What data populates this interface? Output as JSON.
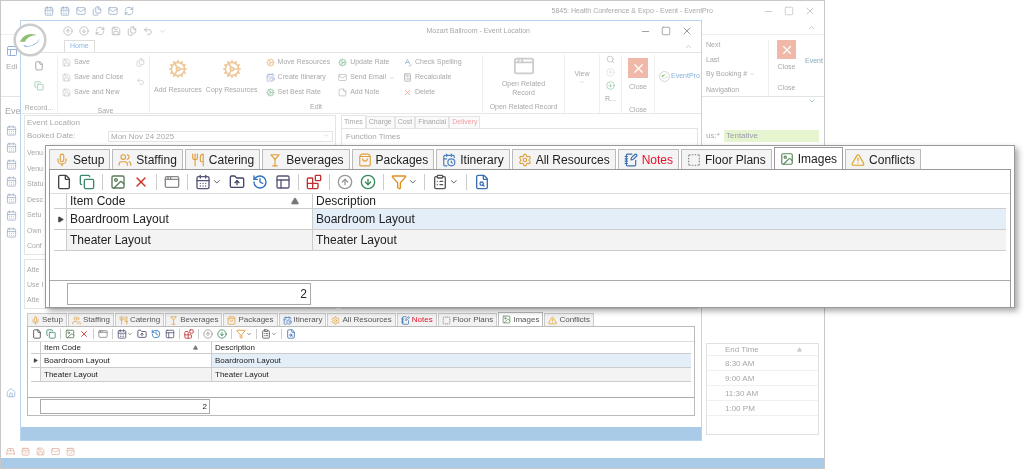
{
  "outer_window": {
    "title": "5845: Health Conference & Expo - Event - EventPro",
    "ribbon_label": "Edi",
    "section_label": "Eve",
    "navigation": {
      "items": [
        {
          "label": "Next",
          "dropdown": false
        },
        {
          "label": "Last",
          "dropdown": false
        },
        {
          "label": "By Booking #",
          "dropdown": true
        }
      ],
      "group": "Navigation"
    },
    "close": {
      "button": "Close",
      "group": "Close"
    },
    "logo_text": "Event",
    "status": {
      "label": "us:*",
      "value": "Tentative"
    },
    "times_grid": {
      "column": {
        "label": "End Time",
        "sorted": true
      },
      "rows": [
        "8:30 AM",
        "9:00 AM",
        "11:30 AM",
        "1:00 PM"
      ]
    }
  },
  "inner_window": {
    "title": "Mozart Ballroom - Event Location",
    "ribbon_tabs": [
      {
        "label": "Home",
        "selected": true
      }
    ],
    "ribbon": {
      "record": {
        "label": "Record..."
      },
      "save": {
        "items": [
          "Save",
          "Save and Close",
          "Save and New"
        ],
        "label": "Save"
      },
      "edit": {
        "large": [
          "Add Resources",
          "Copy Resources"
        ],
        "small": [
          {
            "label": "Move Resources",
            "dropdown": false
          },
          {
            "label": "Create Itinerary",
            "dropdown": false
          },
          {
            "label": "Set Best Rate",
            "dropdown": false
          },
          {
            "label": "Update Rate",
            "dropdown": false
          },
          {
            "label": "Send Email",
            "dropdown": true
          },
          {
            "label": "Add Note",
            "dropdown": false
          },
          {
            "label": "Check Spelling",
            "dropdown": false
          },
          {
            "label": "Recalculate",
            "dropdown": false
          },
          {
            "label": "Delete",
            "dropdown": false
          }
        ],
        "label": "Edit"
      },
      "related": {
        "button": "Open Related Record",
        "label": "Open Related Record"
      },
      "view": {
        "button": "View"
      },
      "reorder": {
        "label": "R..."
      },
      "close": {
        "button": "Close",
        "label": "Close"
      },
      "logo_text": "EventPro"
    },
    "form": {
      "group": "Event Location",
      "booked": {
        "label": "Booked Date:",
        "value": "Mon Nov 24 2025"
      },
      "labels": [
        "Venu",
        "Venu",
        "Statu",
        "Desc",
        "Setu",
        "Own",
        "Conf"
      ],
      "labels_2": [
        "Atte",
        "Use I",
        "Atte"
      ]
    },
    "detail_tabs": [
      {
        "label": "Times",
        "selected": true,
        "alert": false
      },
      {
        "label": "Charge",
        "selected": false,
        "alert": false
      },
      {
        "label": "Cost",
        "selected": false,
        "alert": false
      },
      {
        "label": "Financial",
        "selected": false,
        "alert": false
      },
      {
        "label": "Delivery",
        "selected": false,
        "alert": true
      }
    ],
    "section": "Function Times",
    "resources": {
      "tabs": [
        {
          "label": "Setup",
          "selected": false,
          "alert": false
        },
        {
          "label": "Staffing",
          "selected": false,
          "alert": false
        },
        {
          "label": "Catering",
          "selected": false,
          "alert": false
        },
        {
          "label": "Beverages",
          "selected": false,
          "alert": false
        },
        {
          "label": "Packages",
          "selected": false,
          "alert": false
        },
        {
          "label": "Itinerary",
          "selected": false,
          "alert": false
        },
        {
          "label": "All Resources",
          "selected": false,
          "alert": false
        },
        {
          "label": "Notes",
          "selected": false,
          "alert": true
        },
        {
          "label": "Floor Plans",
          "selected": false,
          "alert": false
        },
        {
          "label": "Images",
          "selected": true,
          "alert": false
        },
        {
          "label": "Conflicts",
          "selected": false,
          "alert": false
        }
      ],
      "columns": [
        {
          "label": "Item Code",
          "sorted": true
        },
        {
          "label": "Description",
          "sorted": false
        }
      ],
      "rows": [
        {
          "cells": [
            "Boardroom Layout",
            "Boardroom Layout"
          ],
          "selected": true
        },
        {
          "cells": [
            "Theater Layout",
            "Theater Layout"
          ],
          "selected": false
        }
      ],
      "count": "2"
    }
  },
  "zoom_callout": {
    "tabs": [
      {
        "label": "Setup",
        "selected": false,
        "alert": false
      },
      {
        "label": "Staffing",
        "selected": false,
        "alert": false
      },
      {
        "label": "Catering",
        "selected": false,
        "alert": false
      },
      {
        "label": "Beverages",
        "selected": false,
        "alert": false
      },
      {
        "label": "Packages",
        "selected": false,
        "alert": false
      },
      {
        "label": "Itinerary",
        "selected": false,
        "alert": false
      },
      {
        "label": "All Resources",
        "selected": false,
        "alert": false
      },
      {
        "label": "Notes",
        "selected": false,
        "alert": true
      },
      {
        "label": "Floor Plans",
        "selected": false,
        "alert": false
      },
      {
        "label": "Images",
        "selected": true,
        "alert": false
      },
      {
        "label": "Conflicts",
        "selected": false,
        "alert": false
      }
    ],
    "columns": [
      {
        "label": "Item Code",
        "sorted": true
      },
      {
        "label": "Description",
        "sorted": false
      }
    ],
    "rows": [
      {
        "cells": [
          "Boardroom Layout",
          "Boardroom Layout"
        ],
        "selected": true
      },
      {
        "cells": [
          "Theater Layout",
          "Theater Layout"
        ],
        "selected": false
      }
    ],
    "count": "2"
  }
}
